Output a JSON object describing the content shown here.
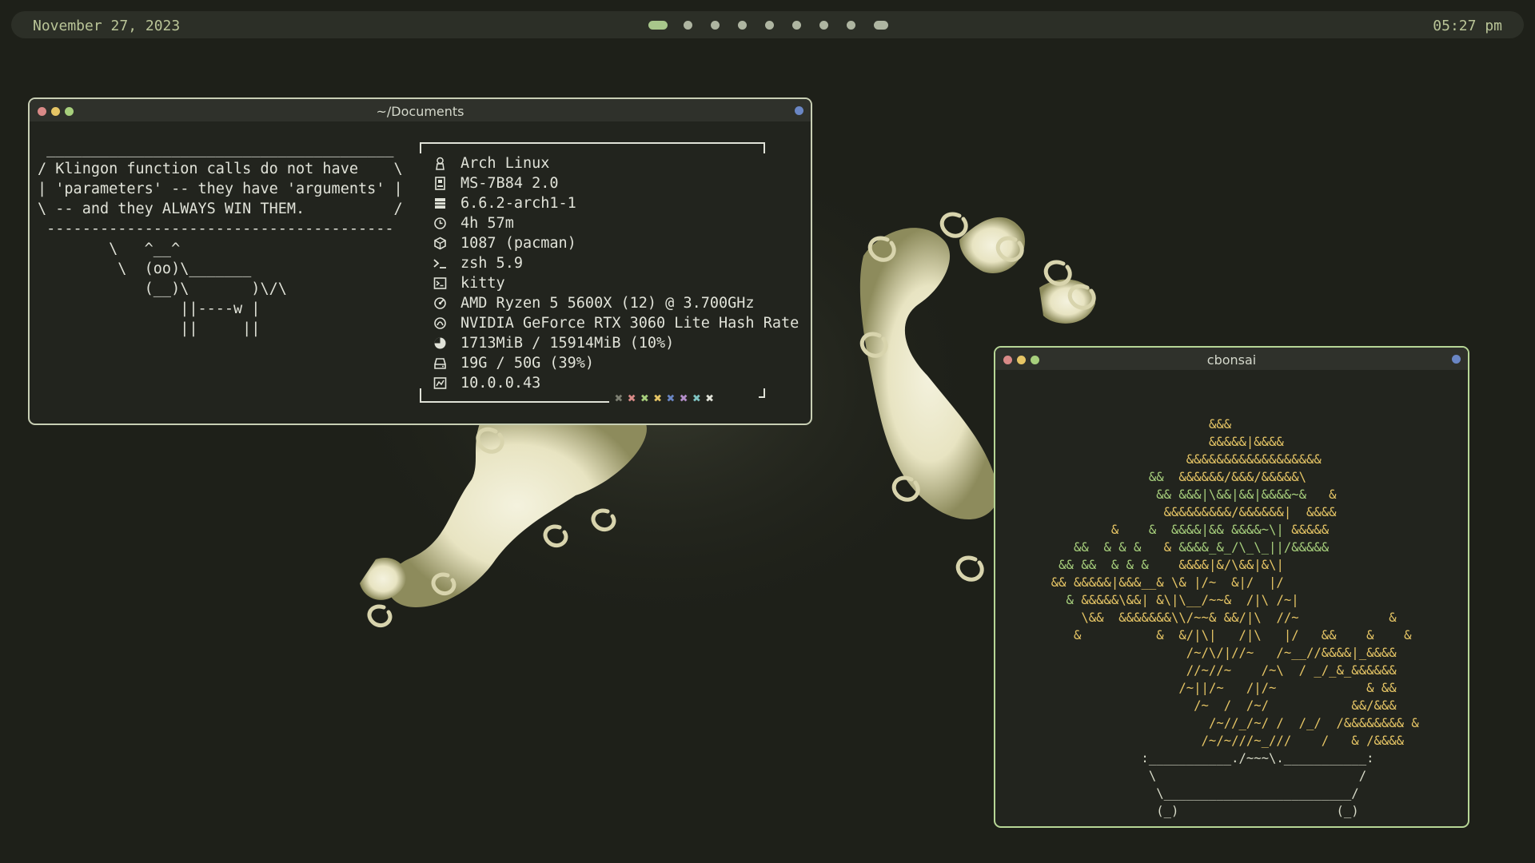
{
  "top_bar": {
    "date": "November 27, 2023",
    "time": "05:27 pm",
    "workspaces": [
      {
        "active": true
      },
      {
        "active": false
      },
      {
        "active": false
      },
      {
        "active": false
      },
      {
        "active": false
      },
      {
        "active": false
      },
      {
        "active": false
      },
      {
        "active": false
      },
      {
        "active": false,
        "wide": true
      }
    ]
  },
  "colors": {
    "background": "#1e2019",
    "bar": "#2c2f27",
    "accent_green": "#a8c78b",
    "window_border": "#c8cfb4",
    "fractal_light": "#f3f1dc"
  },
  "terminal_docs": {
    "title": "~/Documents",
    "cowsay_lines": [
      " _______________________________________",
      "/ Klingon function calls do not have    \\",
      "| 'parameters' -- they have 'arguments' |",
      "\\ -- and they ALWAYS WIN THEM.          /",
      " ---------------------------------------",
      "        \\   ^__^",
      "         \\  (oo)\\_______",
      "            (__)\\       )\\/\\",
      "                ||----w |",
      "                ||     ||"
    ],
    "fetch": [
      {
        "icon": "linux-icon",
        "text": "Arch Linux"
      },
      {
        "icon": "motherboard-icon",
        "text": "MS-7B84 2.0"
      },
      {
        "icon": "kernel-icon",
        "text": "6.6.2-arch1-1"
      },
      {
        "icon": "clock-icon",
        "text": "4h 57m"
      },
      {
        "icon": "package-icon",
        "text": "1087 (pacman)"
      },
      {
        "icon": "shell-icon",
        "text": "zsh 5.9"
      },
      {
        "icon": "terminal-icon",
        "text": "kitty"
      },
      {
        "icon": "cpu-icon",
        "text": "AMD Ryzen 5 5600X (12) @ 3.700GHz"
      },
      {
        "icon": "gpu-icon",
        "text": "NVIDIA GeForce RTX 3060 Lite Hash Rate"
      },
      {
        "icon": "memory-icon",
        "text": "1713MiB / 15914MiB (10%)"
      },
      {
        "icon": "disk-icon",
        "text": "19G / 50G (39%)"
      },
      {
        "icon": "network-icon",
        "text": "10.0.0.43"
      }
    ],
    "palette_glyph": "✖",
    "palette": [
      "#7d7f72",
      "#d98a87",
      "#a7cf7c",
      "#e6c565",
      "#6a86c4",
      "#b48ec9",
      "#7fc4c2",
      "#e0e2d8"
    ]
  },
  "terminal_bonsai": {
    "title": "cbonsai"
  }
}
